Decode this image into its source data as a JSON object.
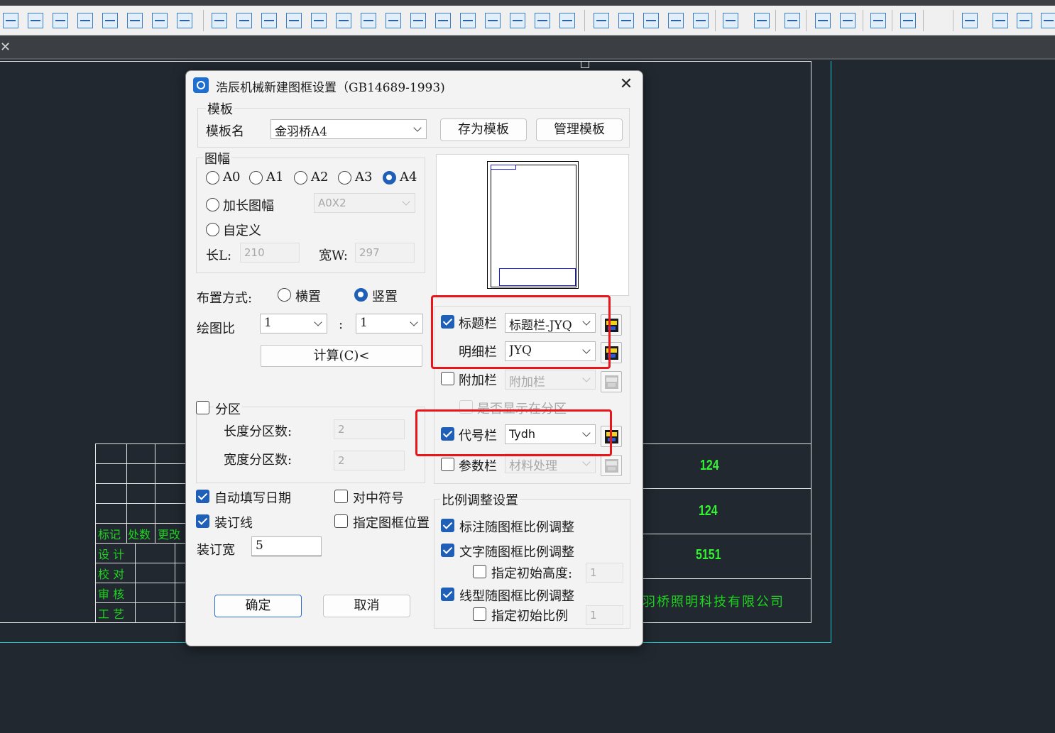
{
  "cad": {
    "detail_numbers": [
      "124",
      "124",
      "5151"
    ],
    "company": "羽桥照明科技有限公司",
    "table_header": [
      "标记",
      "处数",
      "更改"
    ],
    "signature_rows": [
      "设  计",
      "校  对",
      "审  核",
      "工  艺"
    ]
  },
  "dialog": {
    "title": "浩辰机械新建图框设置（GB14689-1993)",
    "template": {
      "group_label": "模板",
      "name_label": "模板名",
      "name_value": "金羽桥A4",
      "save_btn": "存为模板",
      "manage_btn": "管理模板"
    },
    "paper": {
      "group_label": "图幅",
      "sizes": [
        "A0",
        "A1",
        "A2",
        "A3",
        "A4"
      ],
      "selected": "A4",
      "extended_label": "加长图幅",
      "extended_value": "A0X2",
      "custom_label": "自定义",
      "length_label": "长L:",
      "length_value": "210",
      "width_label": "宽W:",
      "width_value": "297"
    },
    "layout": {
      "label": "布置方式:",
      "horizontal": "横置",
      "vertical": "竖置",
      "selected": "竖置"
    },
    "scale": {
      "label": "绘图比",
      "left_value": "1",
      "colon": ":",
      "right_value": "1",
      "calc_btn": "计算(C)<"
    },
    "zone": {
      "label": "分区",
      "checked": false,
      "length_label": "长度分区数:",
      "length_value": "2",
      "width_label": "宽度分区数:",
      "width_value": "2"
    },
    "options": {
      "auto_date": "自动填写日期",
      "center_mark": "对中符号",
      "binding_line": "装订线",
      "frame_position": "指定图框位置",
      "binding_width_label": "装订宽",
      "binding_width_value": "5"
    },
    "bars": {
      "title_bar_label": "标题栏",
      "title_bar_value": "标题栏-JYQ",
      "detail_bar_label": "明细栏",
      "detail_bar_value": "JYQ",
      "extra_bar_label": "附加栏",
      "extra_bar_value": "附加栏",
      "show_zone_label": "是否显示在分区",
      "code_bar_label": "代号栏",
      "code_bar_value": "Tydh",
      "param_bar_label": "参数栏",
      "param_bar_value": "材料处理"
    },
    "ratio": {
      "group_label": "比例调整设置",
      "dim_follow": "标注随图框比例调整",
      "text_follow": "文字随图框比例调整",
      "init_height_label": "指定初始高度:",
      "init_height_value": "1",
      "linetype_follow": "线型随图框比例调整",
      "init_scale_label": "指定初始比例",
      "init_scale_value": "1"
    },
    "ok_btn": "确定",
    "cancel_btn": "取消"
  },
  "colors": {
    "highlight": "#e8161b",
    "checked": "#1f5fb8",
    "cad_text": "#1ed41e",
    "cad_frame": "#17c6c6"
  }
}
